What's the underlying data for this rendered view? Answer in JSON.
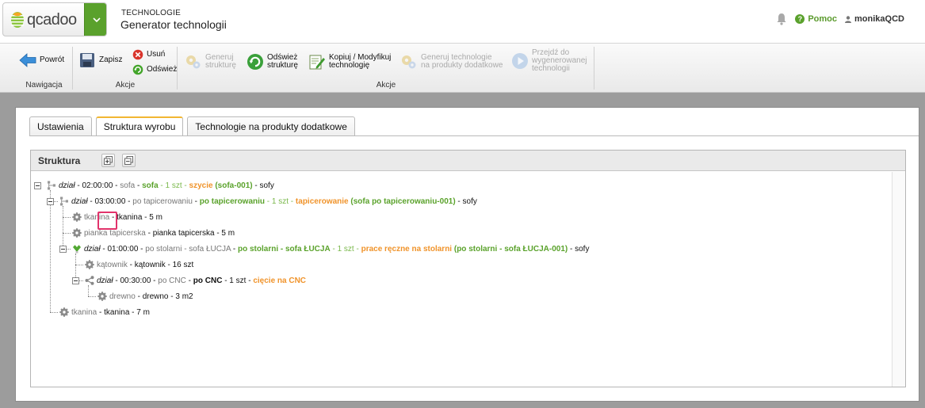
{
  "header": {
    "logo_text": "qcadoo",
    "module": "TECHNOLOGIE",
    "title": "Generator technologii",
    "help": "Pomoc",
    "user": "monikaQCD"
  },
  "ribbon": {
    "nav_group": "Nawigacja",
    "back": "Powrót",
    "actions_group_1": "Akcje",
    "save": "Zapisz",
    "delete": "Usuń",
    "refresh": "Odśwież",
    "actions_group_2": "Akcje",
    "generate_structure": [
      "Generuj",
      "strukturę"
    ],
    "refresh_structure": [
      "Odśwież",
      "strukturę"
    ],
    "copy_modify": [
      "Kopiuj / Modyfikuj",
      "technologię"
    ],
    "generate_additional": [
      "Generuj technologie",
      "na produkty dodatkowe"
    ],
    "goto_generated": [
      "Przejdź do",
      "wygenerowanej",
      "technologii"
    ]
  },
  "tabs": [
    {
      "label": "Ustawienia",
      "active": false
    },
    {
      "label": "Struktura wyrobu",
      "active": true
    },
    {
      "label": "Technologie na produkty dodatkowe",
      "active": false
    }
  ],
  "structure": {
    "title": "Struktura",
    "nodes": [
      {
        "level": 0,
        "icon": "operation-icon",
        "segments": [
          {
            "t": "dział",
            "s": "it"
          },
          {
            "t": " - 02:00:00 - ",
            "s": "dark"
          },
          {
            "t": "sofa",
            "s": "gray"
          },
          {
            "t": " - ",
            "s": "dark"
          },
          {
            "t": "sofa",
            "s": "green"
          },
          {
            "t": " - 1 szt - ",
            "s": "green-light"
          },
          {
            "t": "szycie",
            "s": "orange"
          },
          {
            "t": " (sofa-001)",
            "s": "green"
          },
          {
            "t": " - sofy",
            "s": "dark"
          }
        ]
      },
      {
        "level": 1,
        "icon": "operation-icon",
        "segments": [
          {
            "t": "dział",
            "s": "it"
          },
          {
            "t": " - 03:00:00 - ",
            "s": "dark"
          },
          {
            "t": "po tapicerowaniu",
            "s": "gray"
          },
          {
            "t": " - ",
            "s": "dark"
          },
          {
            "t": "po tapicerowaniu",
            "s": "green"
          },
          {
            "t": " - 1 szt - ",
            "s": "green-light"
          },
          {
            "t": "tapicerowanie",
            "s": "orange"
          },
          {
            "t": " (sofa po tapicerowaniu-001)",
            "s": "green"
          },
          {
            "t": " - sofy",
            "s": "dark"
          }
        ]
      },
      {
        "level": 2,
        "icon": "component-icon",
        "segments": [
          {
            "t": "tkanina",
            "s": "gray"
          },
          {
            "t": " - tkanina - 5 m",
            "s": "dark"
          }
        ]
      },
      {
        "level": 2,
        "icon": "component-icon",
        "segments": [
          {
            "t": "pianka tapicerska",
            "s": "gray"
          },
          {
            "t": " - pianka tapicerska - 5 m",
            "s": "dark"
          }
        ]
      },
      {
        "level": 2,
        "icon": "selected-operation-icon",
        "segments": [
          {
            "t": "dział",
            "s": "it"
          },
          {
            "t": " - 01:00:00 - ",
            "s": "dark"
          },
          {
            "t": "po stolarni - sofa ŁUCJA",
            "s": "gray"
          },
          {
            "t": " - ",
            "s": "dark"
          },
          {
            "t": "po stolarni - sofa ŁUCJA",
            "s": "green"
          },
          {
            "t": " - 1 szt - ",
            "s": "green-light"
          },
          {
            "t": "prace ręczne na stolarni",
            "s": "orange"
          },
          {
            "t": " (po stolarni - sofa ŁUCJA-001)",
            "s": "green"
          },
          {
            "t": " - sofy",
            "s": "dark"
          }
        ]
      },
      {
        "level": 3,
        "icon": "component-icon",
        "segments": [
          {
            "t": "kątownik",
            "s": "gray"
          },
          {
            "t": " - kątownik - 16 szt",
            "s": "dark"
          }
        ]
      },
      {
        "level": 3,
        "icon": "share-icon",
        "segments": [
          {
            "t": "dział",
            "s": "it"
          },
          {
            "t": " - 00:30:00 - ",
            "s": "dark"
          },
          {
            "t": "po CNC",
            "s": "gray"
          },
          {
            "t": " - ",
            "s": "dark"
          },
          {
            "t": "po CNC",
            "s": "bold"
          },
          {
            "t": " - 1 szt - ",
            "s": "dark"
          },
          {
            "t": "cięcie na CNC",
            "s": "orange"
          }
        ]
      },
      {
        "level": 4,
        "icon": "component-icon",
        "segments": [
          {
            "t": "drewno",
            "s": "gray"
          },
          {
            "t": " - drewno - 3 m2",
            "s": "dark"
          }
        ]
      },
      {
        "level": 1,
        "icon": "component-icon",
        "segments": [
          {
            "t": "tkanina",
            "s": "gray"
          },
          {
            "t": " - tkanina - 7 m",
            "s": "dark"
          }
        ]
      }
    ]
  }
}
